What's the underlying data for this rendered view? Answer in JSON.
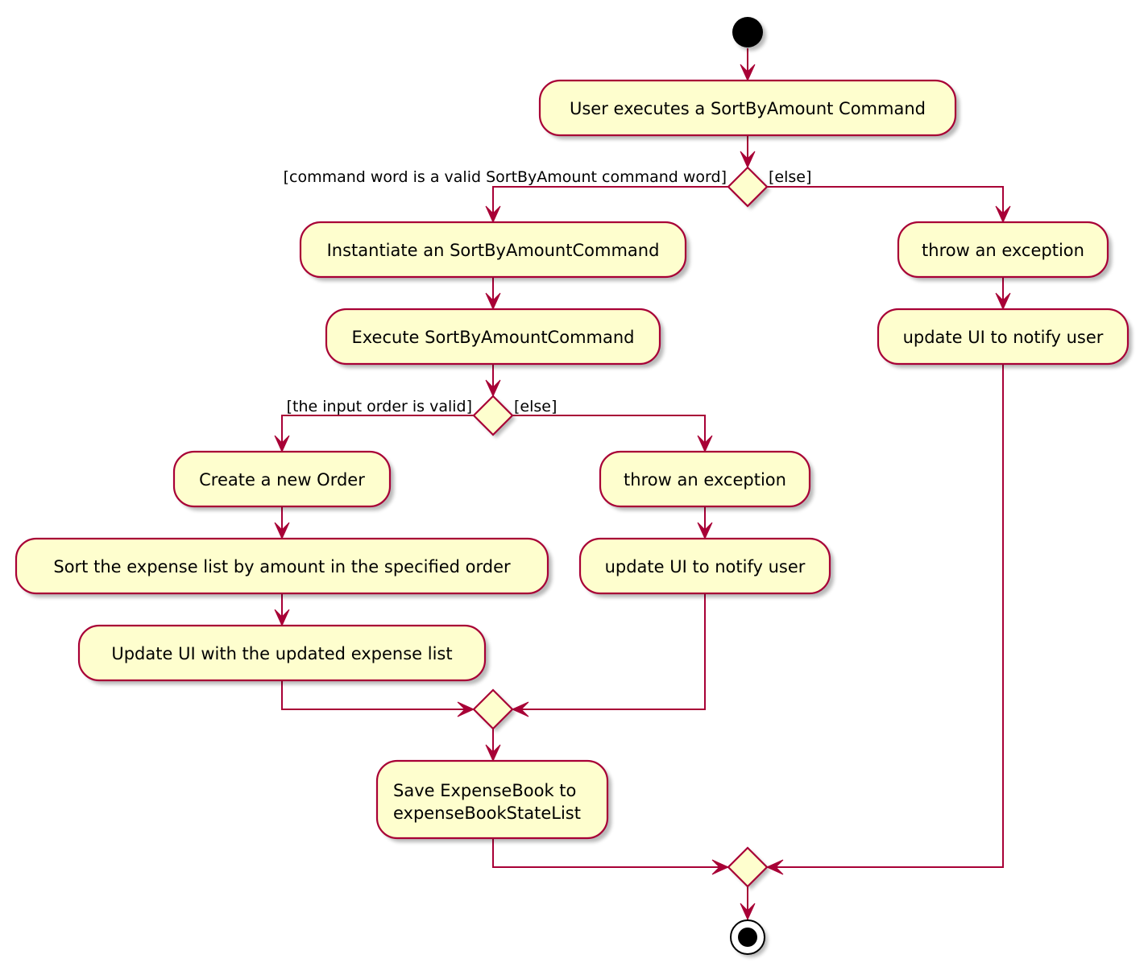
{
  "diagram": {
    "type": "UML activity diagram",
    "colors": {
      "fill": "#FEFECE",
      "stroke": "#A80036",
      "text": "#000000",
      "node_black": "#000000"
    },
    "start_node": {
      "label": "start"
    },
    "end_node": {
      "label": "stop"
    },
    "activities": {
      "user_exec": {
        "lines": [
          "User executes a SortByAmount Command"
        ]
      },
      "instantiate": {
        "lines": [
          "Instantiate an SortByAmountCommand"
        ]
      },
      "execute": {
        "lines": [
          "Execute SortByAmountCommand"
        ]
      },
      "throw_outer": {
        "lines": [
          "throw an exception"
        ]
      },
      "notify_outer": {
        "lines": [
          "update UI to notify user"
        ]
      },
      "create_order": {
        "lines": [
          "Create a new Order"
        ]
      },
      "sort_list": {
        "lines": [
          "Sort the expense list by amount in the specified order"
        ]
      },
      "update_ui": {
        "lines": [
          "Update UI with the updated expense list"
        ]
      },
      "throw_inner": {
        "lines": [
          "throw an exception"
        ]
      },
      "notify_inner": {
        "lines": [
          "update UI to notify user"
        ]
      },
      "save_book": {
        "lines": [
          "Save ExpenseBook to",
          "expenseBookStateList"
        ]
      }
    },
    "decisions": {
      "d1": {
        "guard_yes": "[command word is a valid SortByAmount command word]",
        "guard_no": "[else]"
      },
      "d2": {
        "guard_yes": "[the input order is valid]",
        "guard_no": "[else]"
      }
    },
    "merges": [
      "m2",
      "m1"
    ],
    "flow": [
      [
        "start",
        "user_exec"
      ],
      [
        "user_exec",
        "d1"
      ],
      [
        "d1",
        "instantiate",
        "yes"
      ],
      [
        "d1",
        "throw_outer",
        "no"
      ],
      [
        "instantiate",
        "execute"
      ],
      [
        "execute",
        "d2"
      ],
      [
        "d2",
        "create_order",
        "yes"
      ],
      [
        "d2",
        "throw_inner",
        "no"
      ],
      [
        "create_order",
        "sort_list"
      ],
      [
        "sort_list",
        "update_ui"
      ],
      [
        "update_ui",
        "m2"
      ],
      [
        "throw_inner",
        "notify_inner"
      ],
      [
        "notify_inner",
        "m2"
      ],
      [
        "m2",
        "save_book"
      ],
      [
        "save_book",
        "m1"
      ],
      [
        "throw_outer",
        "notify_outer"
      ],
      [
        "notify_outer",
        "m1"
      ],
      [
        "m1",
        "stop"
      ]
    ]
  }
}
